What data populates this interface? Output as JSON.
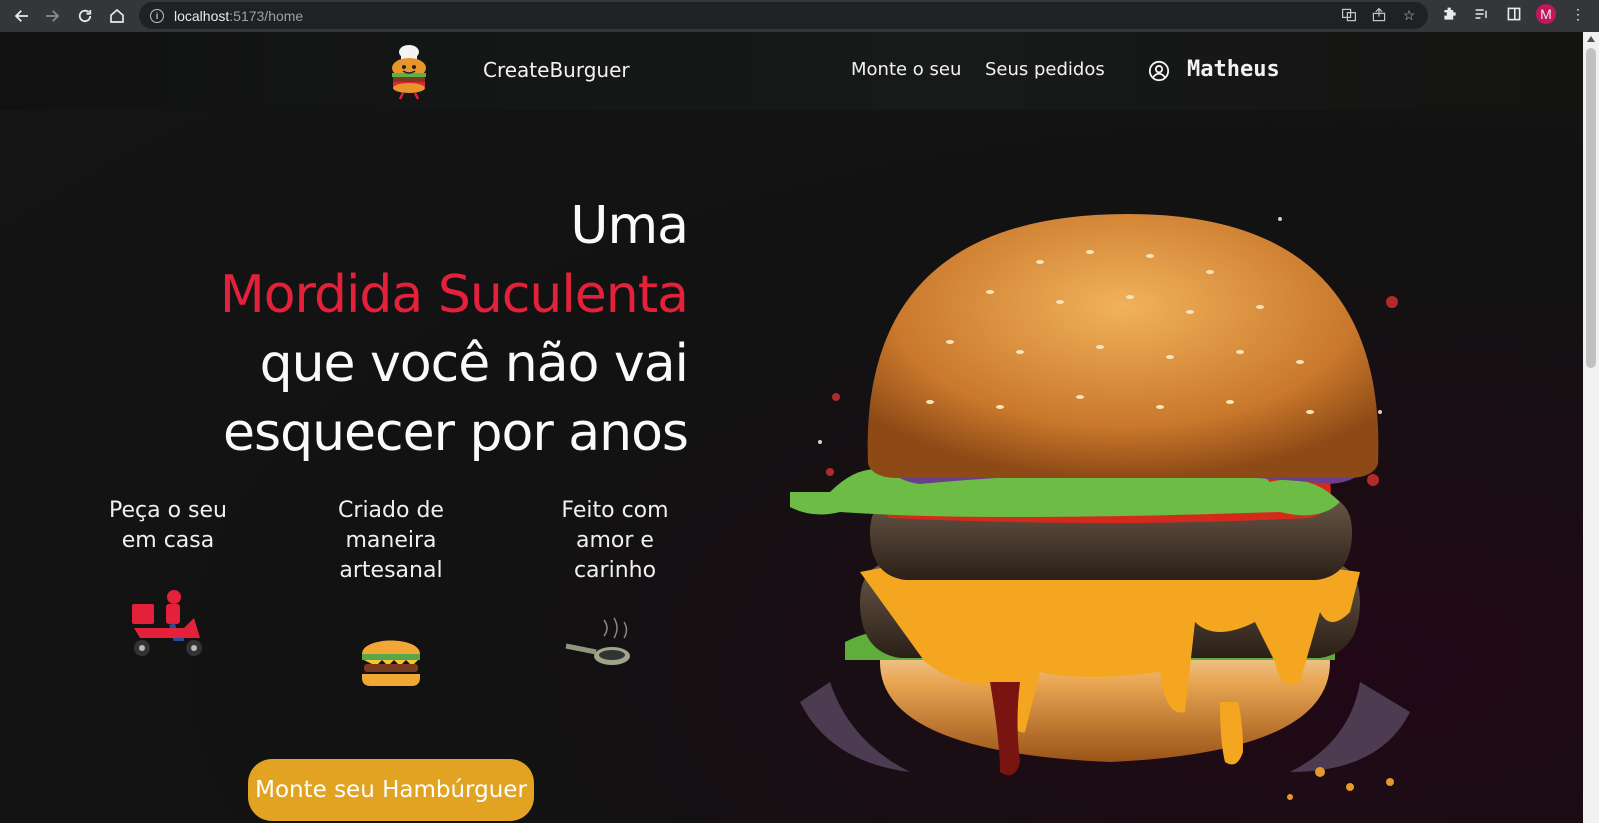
{
  "browser": {
    "url_host": "localhost",
    "url_path": ":5173/home",
    "profile_initial": "M"
  },
  "header": {
    "brand": "CreateBurguer",
    "nav": [
      "Monte o seu",
      "Seus pedidos"
    ],
    "user": "Matheus"
  },
  "hero": {
    "line1": "Uma",
    "line2": "Mordida Suculenta",
    "line3": "que você não vai",
    "line4": "esquecer por anos",
    "accent_color": "#e3213b"
  },
  "features": [
    {
      "lines": [
        "Peça o seu",
        "em casa"
      ],
      "icon": "delivery-scooter-icon"
    },
    {
      "lines": [
        "Criado de",
        "maneira",
        "artesanal"
      ],
      "icon": "burger-icon"
    },
    {
      "lines": [
        "Feito com",
        "amor e",
        "carinho"
      ],
      "icon": "frying-pan-icon"
    }
  ],
  "cta": {
    "label": "Monte seu Hambúrguer",
    "color": "#e1a321"
  }
}
